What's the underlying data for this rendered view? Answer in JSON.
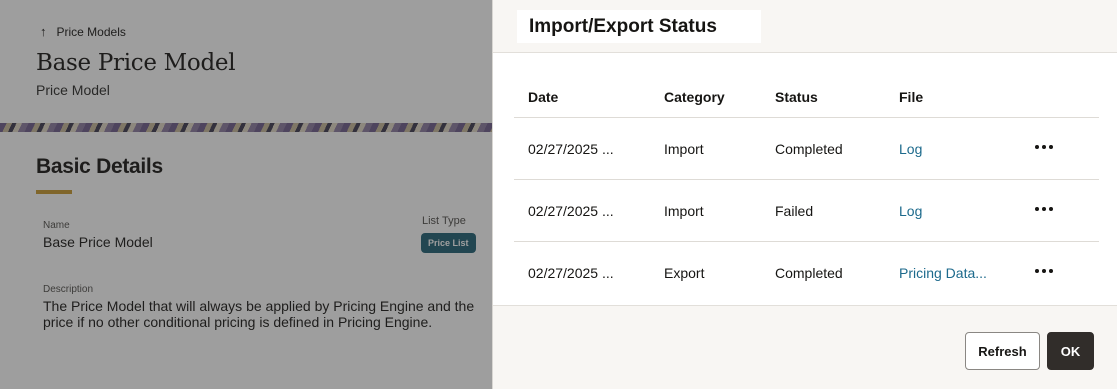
{
  "background_page": {
    "back_link": "Price Models",
    "title": "Base Price Model",
    "subtitle": "Price Model",
    "section_title": "Basic Details",
    "fields": {
      "name_label": "Name",
      "name_value": "Base Price Model",
      "list_type_label": "List Type",
      "list_type_value": "Price List",
      "description_label": "Description",
      "description_line1": "The Price Model that will always be applied by Pricing Engine and the",
      "description_line2": "price if no other conditional pricing is defined in Pricing Engine."
    },
    "accent_color": "#c99a2e",
    "badge_color": "#1e5f73"
  },
  "drawer": {
    "title": "Import/Export Status",
    "columns": [
      "Date",
      "Category",
      "Status",
      "File"
    ],
    "rows": [
      {
        "date": "02/27/2025 ...",
        "category": "Import",
        "status": "Completed",
        "file": "Log"
      },
      {
        "date": "02/27/2025 ...",
        "category": "Import",
        "status": "Failed",
        "file": "Log"
      },
      {
        "date": "02/27/2025 ...",
        "category": "Export",
        "status": "Completed",
        "file": "Pricing Data..."
      }
    ],
    "refresh_label": "Refresh",
    "ok_label": "OK",
    "link_color": "#1d6a8c"
  }
}
